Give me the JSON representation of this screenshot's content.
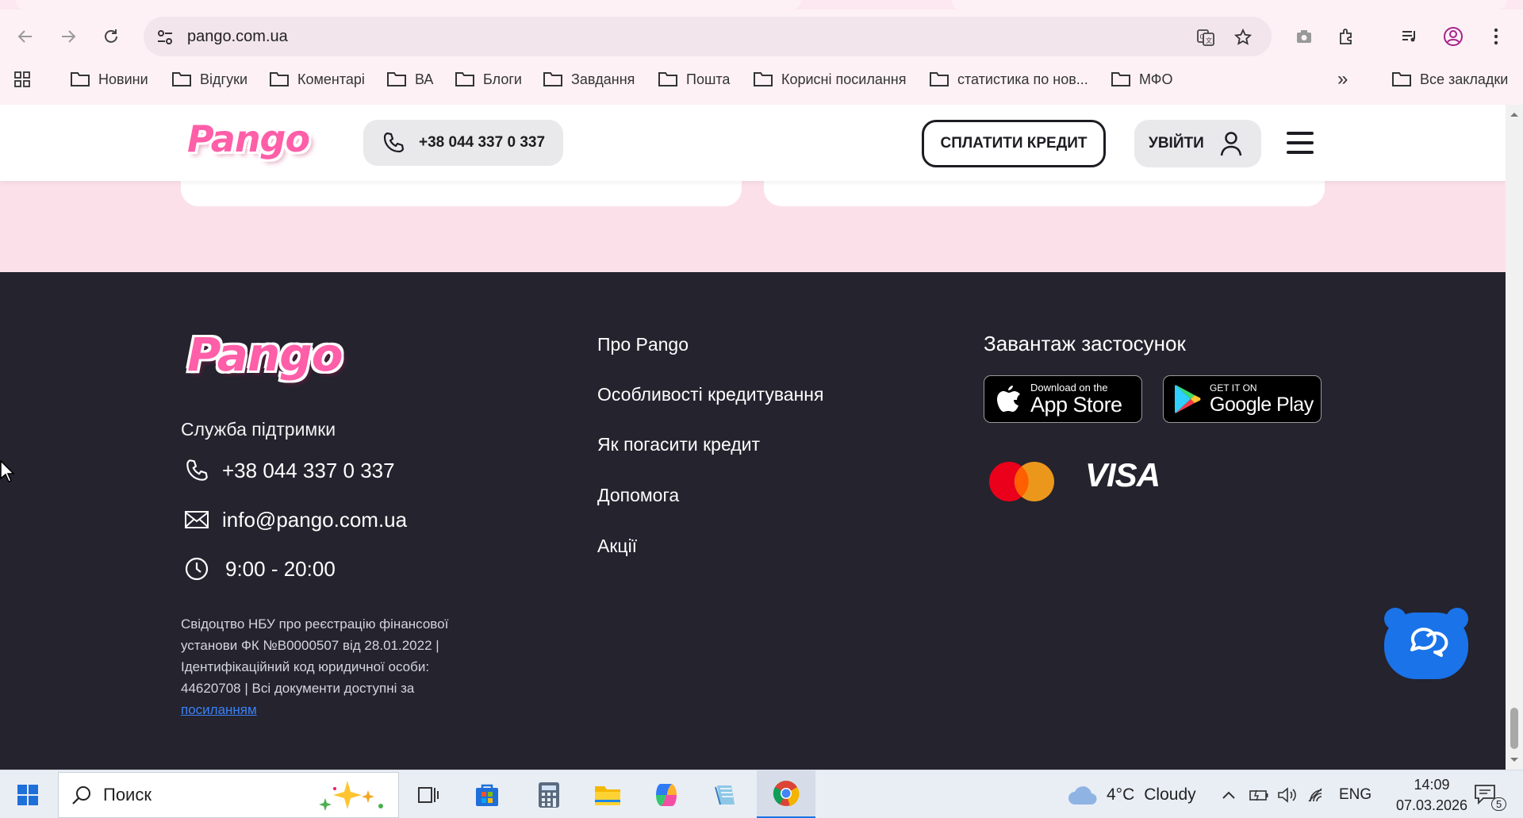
{
  "browser": {
    "url": "pango.com.ua",
    "bookmarks": [
      "Новини",
      "Відгуки",
      "Коментарі",
      "ВА",
      "Блоги",
      "Завдання",
      "Пошта",
      "Корисні посилання",
      "статистика по нов...",
      "МФО"
    ],
    "all_bookmarks": "Все закладки",
    "more": "»"
  },
  "header": {
    "logo": "Pango",
    "phone": "+38 044 337 0 337",
    "pay_credit": "СПЛАТИТИ КРЕДИТ",
    "login": "УВІЙТИ"
  },
  "footer": {
    "logo": "Pango",
    "support_title": "Служба підтримки",
    "phone": "+38 044 337 0 337",
    "email": "info@pango.com.ua",
    "hours": "9:00 - 20:00",
    "legal_text": "Свідоцтво НБУ про реєстрацію фінансової установи ФК №B0000507 від 28.01.2022 | Ідентифікаційний код юридичної особи: 44620708 | Всі документи доступні за ",
    "legal_link": "посиланням",
    "nav": [
      "Про Pango",
      "Особливості кредитування",
      "Як погасити кредит",
      "Допомога",
      "Акції"
    ],
    "app_title": "Завантаж застосунок",
    "app_store": {
      "small": "Download on the",
      "big": "App Store"
    },
    "google_play": {
      "small": "GET IT ON",
      "big": "Google Play"
    },
    "visa": "VISA"
  },
  "taskbar": {
    "search_placeholder": "Поиск",
    "weather_temp": "4°C",
    "weather_desc": "Cloudy",
    "lang": "ENG",
    "time": "14:09",
    "date": "07.03.2026",
    "notifications": "5"
  },
  "colors": {
    "brand_pink": "#ff5ea8",
    "footer_bg": "#24232e",
    "page_pink": "#fbe0ea",
    "chat_blue": "#1a73e8"
  }
}
